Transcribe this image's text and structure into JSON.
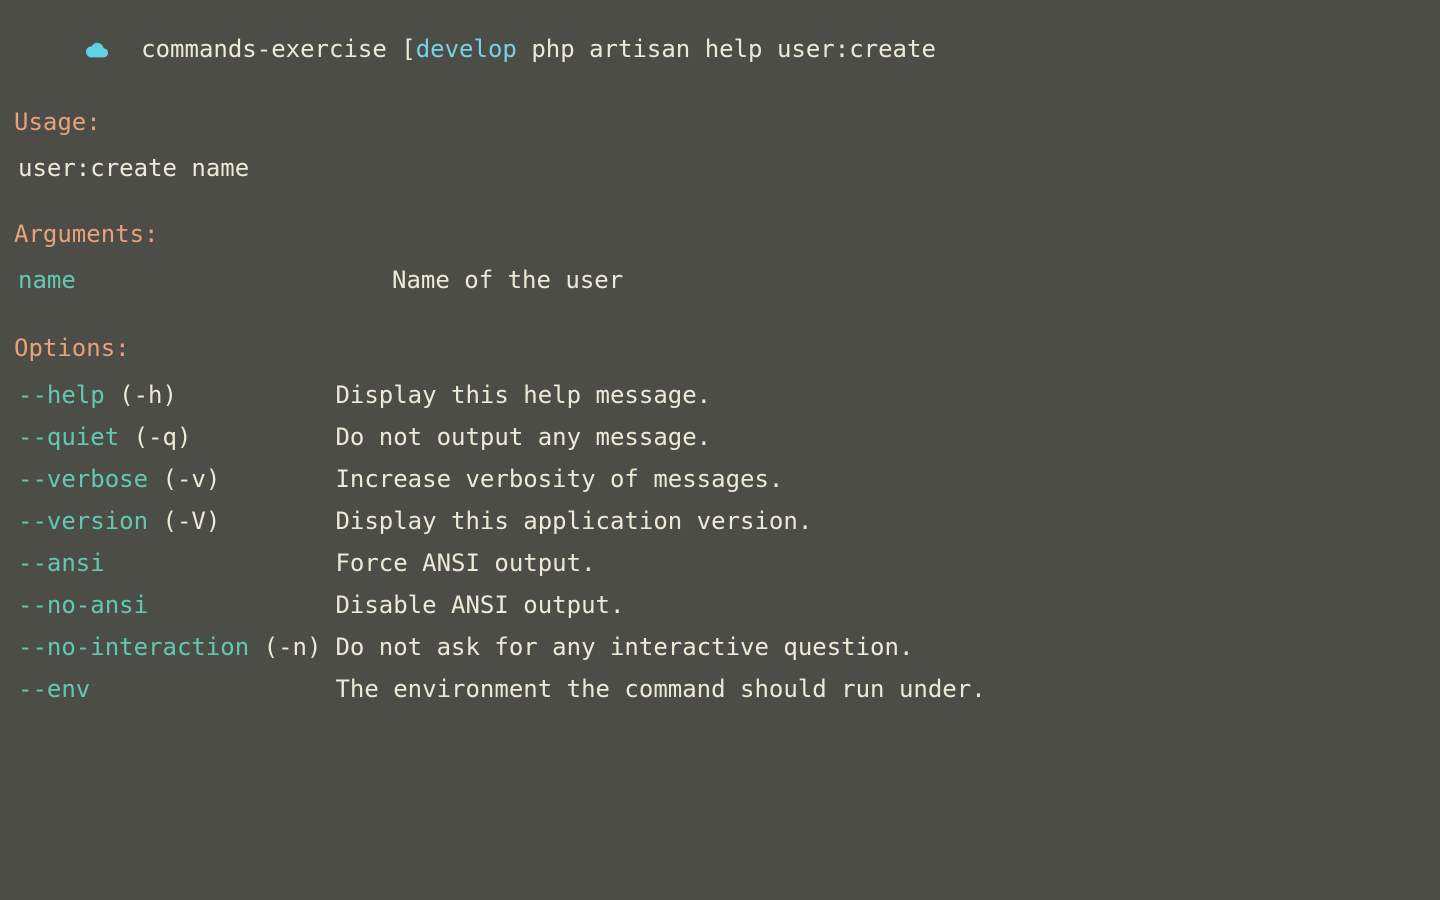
{
  "prompt": {
    "cwd": "commands-exercise",
    "bracket_open": "[",
    "branch": "develop",
    "command": "php artisan help user:create"
  },
  "sections": {
    "usage_heading": "Usage:",
    "usage_body": "user:create name",
    "arguments_heading": "Arguments:",
    "options_heading": "Options:"
  },
  "arguments": [
    {
      "name": "name",
      "desc": "Name of the user"
    }
  ],
  "options": [
    {
      "flag": "--help",
      "short": "(-h)",
      "desc": "Display this help message."
    },
    {
      "flag": "--quiet",
      "short": "(-q)",
      "desc": "Do not output any message."
    },
    {
      "flag": "--verbose",
      "short": "(-v)",
      "desc": "Increase verbosity of messages."
    },
    {
      "flag": "--version",
      "short": "(-V)",
      "desc": "Display this application version."
    },
    {
      "flag": "--ansi",
      "short": "",
      "desc": "Force ANSI output."
    },
    {
      "flag": "--no-ansi",
      "short": "",
      "desc": "Disable ANSI output."
    },
    {
      "flag": "--no-interaction",
      "short": "(-n)",
      "desc": "Do not ask for any interactive question."
    },
    {
      "flag": "--env",
      "short": "",
      "desc": "The environment the command should run under."
    }
  ]
}
